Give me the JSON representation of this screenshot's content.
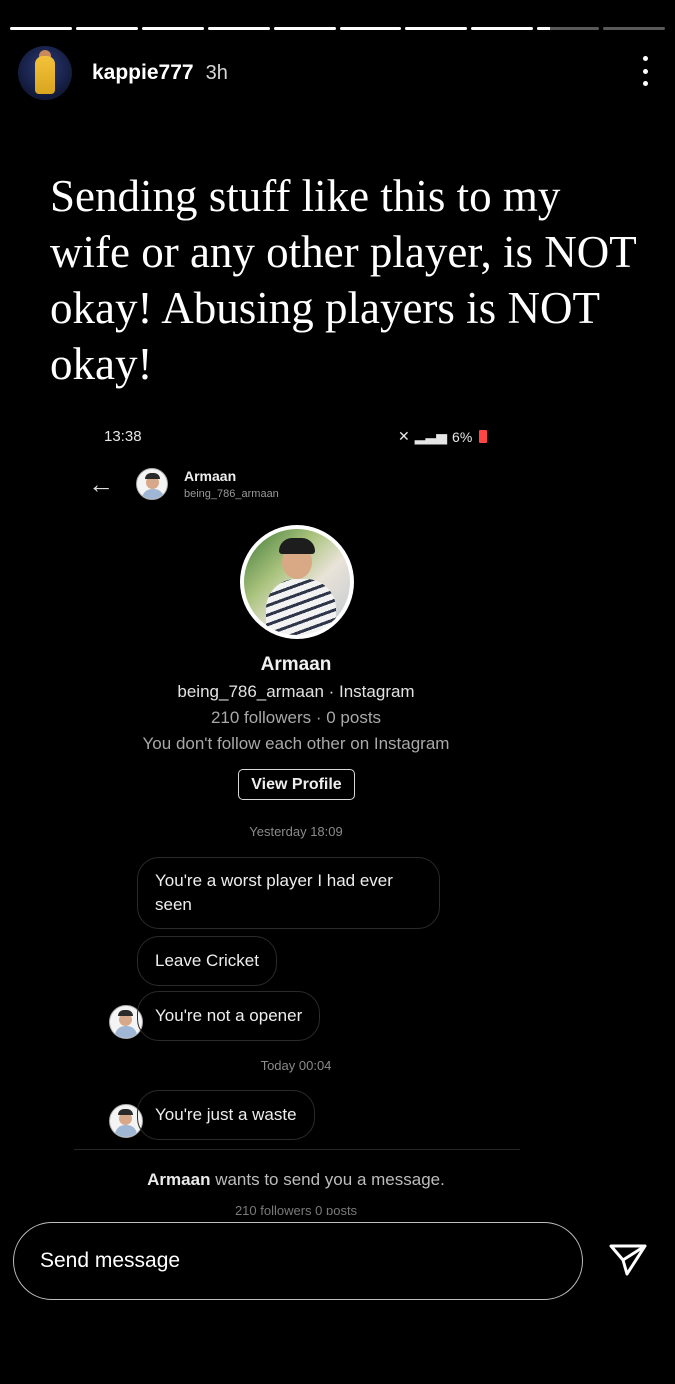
{
  "story": {
    "progress_segments": [
      1,
      1,
      1,
      1,
      1,
      1,
      1,
      1,
      0.2,
      0
    ],
    "username": "kappie777",
    "time": "3h",
    "caption": "Sending stuff like this to my wife or any other player, is NOT okay! Abusing players is NOT okay!"
  },
  "screenshot": {
    "status_time": "13:38",
    "status_battery": "6%",
    "header": {
      "name": "Armaan",
      "handle": "being_786_armaan"
    },
    "profile": {
      "name": "Armaan",
      "handle_line": "being_786_armaan · Instagram",
      "stats_line": "210 followers · 0 posts",
      "follow_line": "You don't follow each other on Instagram",
      "view_profile_label": "View Profile"
    },
    "timestamps": {
      "first": "Yesterday 18:09",
      "second": "Today 00:04"
    },
    "messages": [
      "You're a worst player I had ever seen",
      "Leave Cricket",
      "You're not a opener",
      "You're just a waste"
    ],
    "request": {
      "name": "Armaan",
      "text": " wants to send you a message.",
      "sub": "210 followers 0 posts"
    }
  },
  "send_bar": {
    "placeholder": "Send message"
  }
}
